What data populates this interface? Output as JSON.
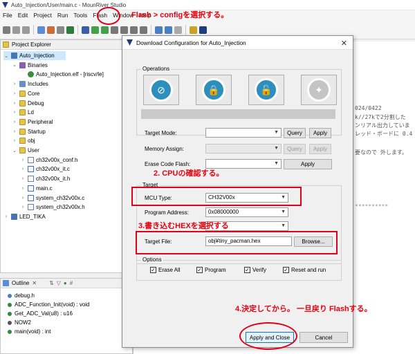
{
  "window": {
    "title": "Auto_Injection/User/main.c - MounRiver Studio"
  },
  "menu": [
    "File",
    "Edit",
    "Project",
    "Run",
    "Tools",
    "Flash",
    "Window",
    "Help"
  ],
  "explorer": {
    "title": "Project Explorer",
    "items": [
      {
        "label": "Auto_Injection",
        "icon": "proj",
        "indent": 0,
        "twisty": "v"
      },
      {
        "label": "Binaries",
        "icon": "bin",
        "indent": 1,
        "twisty": "v"
      },
      {
        "label": "Auto_Injection.elf - [riscv/le]",
        "icon": "elf",
        "indent": 2,
        "twisty": ""
      },
      {
        "label": "Includes",
        "icon": "inc",
        "indent": 1,
        "twisty": ">"
      },
      {
        "label": "Core",
        "icon": "folder",
        "indent": 1,
        "twisty": ">"
      },
      {
        "label": "Debug",
        "icon": "folder",
        "indent": 1,
        "twisty": ">"
      },
      {
        "label": "Ld",
        "icon": "folder",
        "indent": 1,
        "twisty": ">"
      },
      {
        "label": "Peripheral",
        "icon": "folder",
        "indent": 1,
        "twisty": ">"
      },
      {
        "label": "Startup",
        "icon": "folder",
        "indent": 1,
        "twisty": ">"
      },
      {
        "label": "obj",
        "icon": "folder",
        "indent": 1,
        "twisty": ">"
      },
      {
        "label": "User",
        "icon": "folder",
        "indent": 1,
        "twisty": "v"
      },
      {
        "label": "ch32v00x_conf.h",
        "icon": "hfile",
        "indent": 2,
        "twisty": ">"
      },
      {
        "label": "ch32v00x_it.c",
        "icon": "cfile",
        "indent": 2,
        "twisty": ">"
      },
      {
        "label": "ch32v00x_it.h",
        "icon": "hfile",
        "indent": 2,
        "twisty": ">"
      },
      {
        "label": "main.c",
        "icon": "cfile",
        "indent": 2,
        "twisty": ">"
      },
      {
        "label": "system_ch32v00x.c",
        "icon": "cfile",
        "indent": 2,
        "twisty": ">"
      },
      {
        "label": "system_ch32v00x.h",
        "icon": "hfile",
        "indent": 2,
        "twisty": ">"
      },
      {
        "label": "LED_TIKA",
        "icon": "proj",
        "indent": 0,
        "twisty": ">"
      }
    ]
  },
  "outline": {
    "title": "Outline",
    "items": [
      {
        "label": "debug.h",
        "color": "#4a7fc0"
      },
      {
        "label": "ADC_Function_Init(void) : void",
        "color": "#2e8b3a"
      },
      {
        "label": "Get_ADC_Val(u8) : u16",
        "color": "#2e8b3a"
      },
      {
        "label": "NOW2",
        "color": "#555555"
      },
      {
        "label": "main(void) : int",
        "color": "#2e8b3a"
      }
    ]
  },
  "editor": {
    "lines": [
      "024/0422",
      "k//27kで2分割した",
      "ンリアル出力していま",
      "レッド・ボードに 0.4",
      "要なので 外します。"
    ]
  },
  "dialog": {
    "title": "Download Configuration for Auto_Injection",
    "operations_label": "Operations",
    "target_mode_label": "Target Mode:",
    "memory_assign_label": "Memory Assign:",
    "erase_code_flash_label": "Erase Code Flash:",
    "query_label": "Query",
    "apply_label": "Apply",
    "target_group_label": "Target",
    "mcu_type_label": "MCU Type:",
    "mcu_type_value": "CH32V00x",
    "program_address_label": "Program Address:",
    "program_address_value": "0x08000000",
    "target_file_label": "Target File:",
    "target_file_value": "obj¥tiny_pacman.hex",
    "browse_label": "Browse...",
    "options_label": "Options",
    "erase_all_label": "Erase All",
    "program_label": "Program",
    "verify_label": "Verify",
    "reset_label": "Reset and run",
    "apply_close_label": "Apply and Close",
    "cancel_label": "Cancel"
  },
  "annotations": {
    "step1": "Flash > configを選択する。",
    "step2": "2. CPUの確認する。",
    "step3": "3.書き込むHEXを選択する",
    "step4": "4.決定してから。 一旦戻り Flashする。"
  },
  "colors": {
    "annotation": "#e0001a",
    "accent": "#0078d7"
  }
}
